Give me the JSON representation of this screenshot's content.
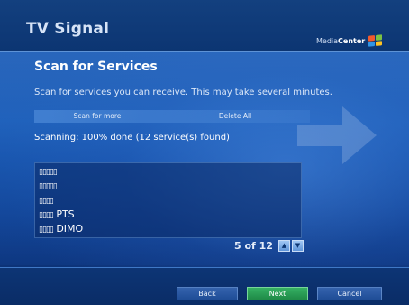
{
  "header": {
    "title": "TV Signal",
    "logo_media": "Media",
    "logo_center": "Center",
    "logo_icon": "windows-flag-icon"
  },
  "main": {
    "page_title": "Scan for Services",
    "description": "Scan for services you can receive. This may take several minutes.",
    "actions": {
      "scan_label": "Scan for more",
      "delete_label": "Delete All"
    },
    "status": "Scanning: 100% done (12 service(s) found)",
    "services": [
      {
        "glyphs": "▯▯▯▯▯",
        "name": ""
      },
      {
        "glyphs": "▯▯▯▯▯",
        "name": ""
      },
      {
        "glyphs": "▯▯▯▯",
        "name": ""
      },
      {
        "glyphs": "▯▯▯▯",
        "name": "PTS"
      },
      {
        "glyphs": "▯▯▯▯",
        "name": "DIMO"
      }
    ],
    "pager": {
      "text": "5 of 12",
      "up_icon": "chevron-up-icon",
      "down_icon": "chevron-down-icon"
    }
  },
  "footer": {
    "back_label": "Back",
    "next_label": "Next",
    "cancel_label": "Cancel"
  },
  "colors": {
    "background": "#1452a8",
    "next_button": "#2a9a52"
  }
}
